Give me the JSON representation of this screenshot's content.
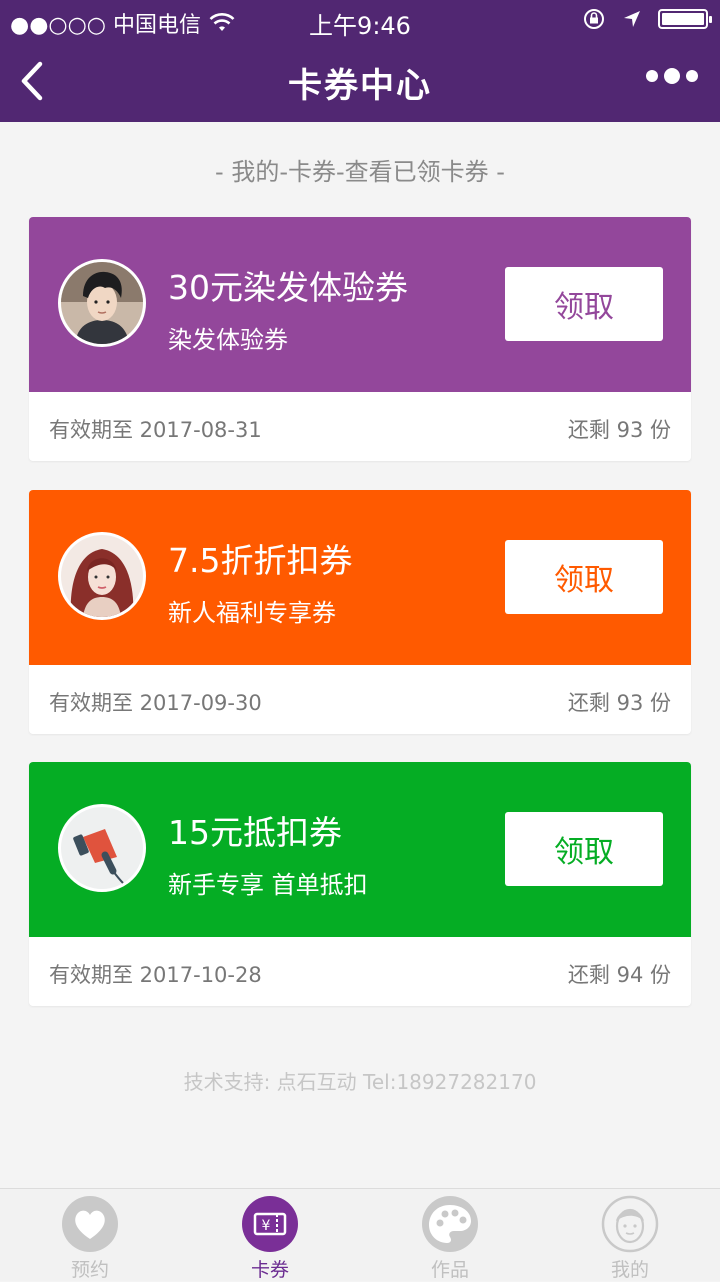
{
  "status_bar": {
    "carrier": "●●○○○ 中国电信",
    "time": "上午9:46"
  },
  "header": {
    "title": "卡券中心"
  },
  "subtitle": "- 我的-卡券-查看已领卡券 -",
  "coupons": [
    {
      "title": "30元染发体验券",
      "desc": "染发体验券",
      "claim_label": "领取",
      "expiry": "有效期至 2017-08-31",
      "remaining": "还剩 93 份",
      "color": "#93479b",
      "avatar": "boy-portrait"
    },
    {
      "title": "7.5折折扣券",
      "desc": "新人福利专享券",
      "claim_label": "领取",
      "expiry": "有效期至 2017-09-30",
      "remaining": "还剩 93 份",
      "color": "#ff5a00",
      "avatar": "girl-portrait"
    },
    {
      "title": "15元抵扣券",
      "desc": "新手专享 首单抵扣",
      "claim_label": "领取",
      "expiry": "有效期至 2017-10-28",
      "remaining": "还剩 94 份",
      "color": "#05ad24",
      "avatar": "hair-dryer-icon"
    }
  ],
  "footer": "技术支持: 点石互动 Tel:18927282170",
  "tabs": [
    {
      "label": "预约",
      "icon": "heart-icon",
      "active": false
    },
    {
      "label": "卡券",
      "icon": "ticket-icon",
      "active": true
    },
    {
      "label": "作品",
      "icon": "palette-icon",
      "active": false
    },
    {
      "label": "我的",
      "icon": "user-icon",
      "active": false
    }
  ]
}
